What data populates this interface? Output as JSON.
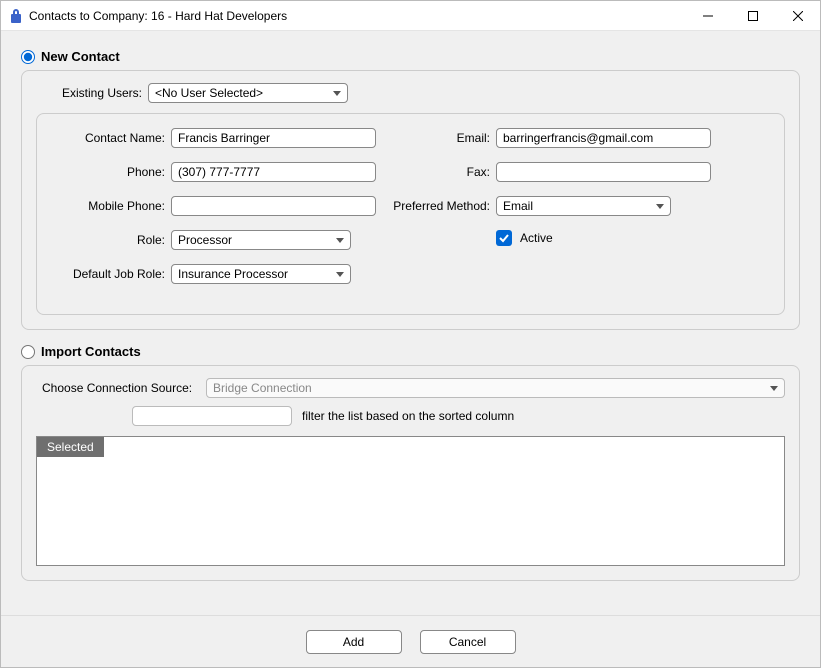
{
  "window": {
    "title": "Contacts to Company: 16 - Hard Hat Developers"
  },
  "mode": {
    "new_contact_label": "New Contact",
    "import_label": "Import Contacts",
    "selected": "new"
  },
  "existing": {
    "label": "Existing Users:",
    "value": "<No User Selected>"
  },
  "left": {
    "contact_name_label": "Contact Name:",
    "contact_name": "Francis Barringer",
    "phone_label": "Phone:",
    "phone": "(307) 777-7777",
    "mobile_label": "Mobile Phone:",
    "mobile": "",
    "role_label": "Role:",
    "role": "Processor",
    "default_job_role_label": "Default Job Role:",
    "default_job_role": "Insurance Processor"
  },
  "right": {
    "email_label": "Email:",
    "email": "barringerfrancis@gmail.com",
    "fax_label": "Fax:",
    "fax": "",
    "preferred_label": "Preferred Method:",
    "preferred": "Email",
    "active_label": "Active",
    "active": true
  },
  "import": {
    "source_label": "Choose Connection Source:",
    "source": "Bridge Connection",
    "filter_hint": "filter the list based on the sorted column",
    "filter_value": "",
    "grid": {
      "columns": [
        "Selected"
      ],
      "rows": []
    }
  },
  "buttons": {
    "add": "Add",
    "cancel": "Cancel"
  }
}
